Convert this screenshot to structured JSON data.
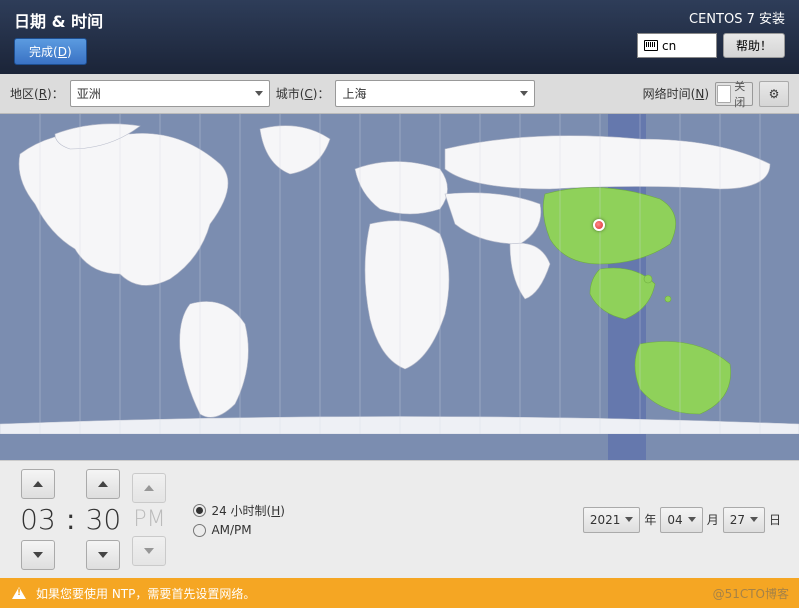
{
  "header": {
    "title": "日期 & 时间",
    "done": "完成(D)",
    "install_title": "CENTOS 7 安装",
    "lang": "cn",
    "help": "帮助！"
  },
  "toolbar": {
    "region_label": "地区(R)：",
    "region_value": "亚洲",
    "city_label": "城市(C)：",
    "city_value": "上海",
    "network_time_label": "网络时间(N)",
    "network_time_state": "关闭"
  },
  "time": {
    "hour": "03",
    "minute": "30",
    "ampm": "PM",
    "format24": "24 小时制(H)",
    "format12": "AM/PM",
    "selected_format": "24"
  },
  "date": {
    "year": "2021",
    "year_suffix": "年",
    "month": "04",
    "month_suffix": "月",
    "day": "27",
    "day_suffix": "日"
  },
  "warning": "如果您要使用 NTP，需要首先设置网络。",
  "watermark": "@51CTO博客",
  "selected_location": {
    "region": "亚洲",
    "city": "上海"
  }
}
